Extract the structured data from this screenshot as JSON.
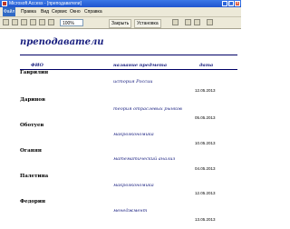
{
  "window": {
    "title": "Microsoft Access - [преподаватели]",
    "buttons": [
      "_",
      "□",
      "×"
    ]
  },
  "menubar": {
    "items": [
      "Файл",
      "Правка",
      "Вид",
      "Сервис",
      "Окно",
      "Справка"
    ]
  },
  "toolbar": {
    "zoom": "100%",
    "close_label": "Закрыть",
    "setup_label": "Установка"
  },
  "report": {
    "title": "преподаватели",
    "headers": {
      "name": "ФИО",
      "subject": "название предмета",
      "date": "дата"
    },
    "rows": [
      {
        "name": "Гаврилин",
        "subject": "история России",
        "date": "12.05.2013"
      },
      {
        "name": "Даринов",
        "subject": "теория отраслевых рынков",
        "date": "05.05.2013"
      },
      {
        "name": "Оботуев",
        "subject": "макроэкономика",
        "date": "10.05.2013"
      },
      {
        "name": "Оганян",
        "subject": "математический анализ",
        "date": "04.05.2013"
      },
      {
        "name": "Палетина",
        "subject": "макроэкономика",
        "date": "12.05.2013"
      },
      {
        "name": "Федорин",
        "subject": "менеджмент",
        "date": "13.05.2013"
      }
    ]
  }
}
